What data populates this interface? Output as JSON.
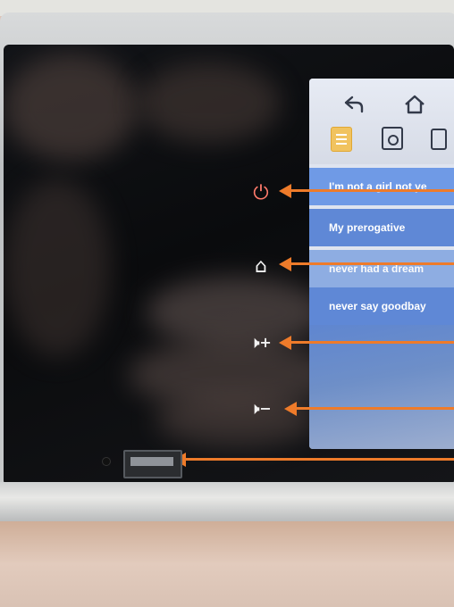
{
  "device": {
    "screen": {
      "nav": {
        "back_icon": "back-arrow-icon",
        "home_icon": "home-icon"
      },
      "toolbar": {
        "list_icon": "playlist-icon",
        "save_icon": "save-icon",
        "usb_icon": "usb-drive-icon"
      },
      "songs": [
        {
          "title": "I'm not a girl not ye"
        },
        {
          "title": "My prerogative"
        },
        {
          "title": "never had a dream"
        },
        {
          "title": "never say goodbay"
        }
      ]
    },
    "side_keys": {
      "power": {
        "glyph": "⏻",
        "icon": "power-icon"
      },
      "home": {
        "glyph": "⌂",
        "icon": "home-icon"
      },
      "volume_up": {
        "glyph": "🕨+",
        "icon": "volume-up-icon"
      },
      "volume_down": {
        "glyph": "🕨−",
        "icon": "volume-down-icon"
      }
    },
    "usb_port": {
      "icon": "usb-port"
    },
    "colors": {
      "arrow": "#ee7b2a",
      "power_key": "#ff7a6b",
      "list_selected": "#6f9ae6",
      "playlist_icon": "#f1c35f"
    }
  }
}
